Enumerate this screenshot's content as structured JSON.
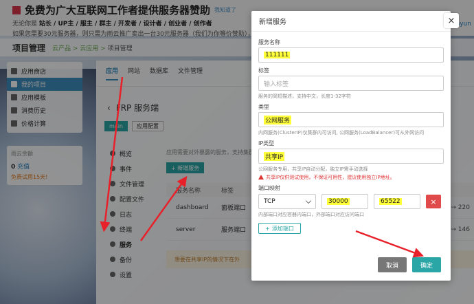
{
  "banner": {
    "title": "免费为广大互联网工作者提供服务器赞助",
    "title_link": "我知道了",
    "line1_prefix": "无论你是",
    "line1_roles": "站长 / UP主 / 服主 / 群主 / 开发者 / 设计者 / 创业者 / 创作者",
    "line2": "如果您需要30元服务器，则只需为雨云推广卖出一台30元服务器（我们为你等价赞助），只要你",
    "line2_right": "n.rainyun"
  },
  "topbar": {
    "title": "项目管理",
    "crumbs": [
      "云产品",
      "云应用",
      "项目管理"
    ]
  },
  "sidebar": {
    "items": [
      {
        "label": "应用商店",
        "icon": "store-icon"
      },
      {
        "label": "我的项目",
        "icon": "folder-icon",
        "active": true
      },
      {
        "label": "应用模板",
        "icon": "template-icon"
      },
      {
        "label": "消费历史",
        "icon": "history-icon"
      },
      {
        "label": "价格计算",
        "icon": "calculator-icon"
      }
    ],
    "balance_label": "雨云余额",
    "balance_value": "0",
    "recharge": "充值",
    "free_trial": "免费试用15天!"
  },
  "main": {
    "tabs": [
      "应用",
      "网站",
      "数据库",
      "文件管理"
    ],
    "service_title": "FRP 服务端",
    "btn_main": "main",
    "btn_config": "应用配置",
    "leftnav": [
      "概览",
      "事件",
      "文件管理",
      "配置文件",
      "日志",
      "终端",
      "服务",
      "备份",
      "设置"
    ],
    "hint": "应用需要对外暴露的服务，支持集群内访",
    "add_service": "+ 新增服务",
    "table_headers": [
      "服务名称",
      "标签"
    ],
    "rows": [
      {
        "name": "dashboard",
        "tag": "面板端口",
        "port": "→ 220"
      },
      {
        "name": "server",
        "tag": "服务端口",
        "port": "→ 146"
      }
    ],
    "warn": "想要在共享IP的情况下在外"
  },
  "modal": {
    "title": "新增服务",
    "close": "×",
    "name_label": "服务名称",
    "name_value": "111111",
    "tag_label": "标签",
    "tag_placeholder": "输入标签",
    "tag_help": "服务的简短描述，支持中文，长度1-32字符",
    "type_label": "类型",
    "type_value": "公网服务",
    "type_help": "内网服务(ClusterIP)仅集群内可访问, 公网服务(LoadBalancer)可从外网访问",
    "iptype_label": "IP类型",
    "iptype_value": "共享IP",
    "iptype_help": "公网服务专用，共享IP自动分配，独立IP需手动选择",
    "iptype_warn": "共享IP仅供测试使用，不保证可用性，建议使用独立IP地址。",
    "port_label": "端口映射",
    "protocol": "TCP",
    "internal_port": "30000",
    "external_port": "65522",
    "port_del": "×",
    "port_help": "内部端口对应容器内端口，外部端口对应访问端口",
    "add_port": "添加端口",
    "cancel": "取消",
    "ok": "确定"
  }
}
